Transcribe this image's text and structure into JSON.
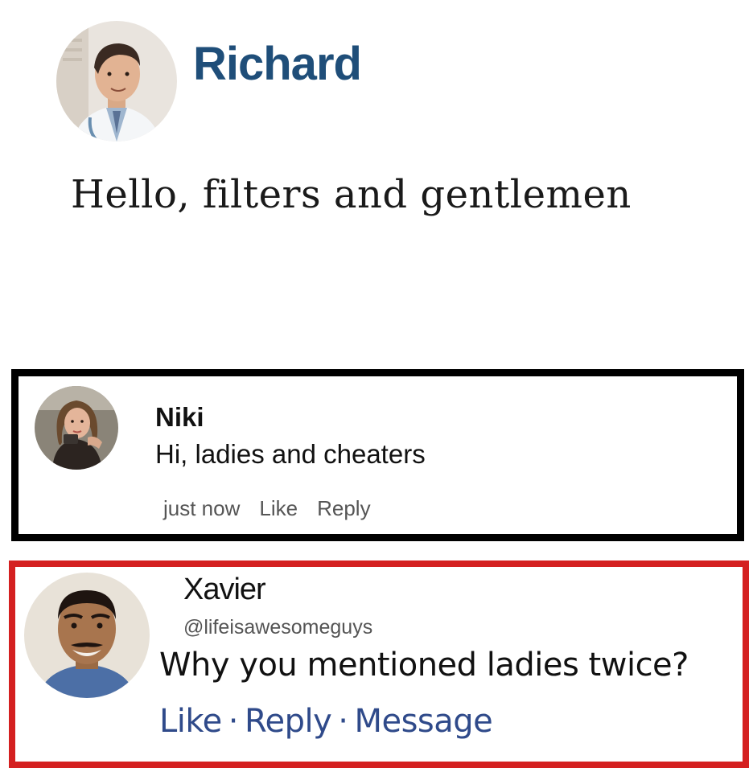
{
  "post": {
    "author": "Richard",
    "text": "Hello, filters and gentlemen",
    "colors": {
      "author_name": "#1f4e79"
    }
  },
  "comment_1": {
    "author": "Niki",
    "text": "Hi, ladies and cheaters",
    "timestamp": "just now",
    "like_label": "Like",
    "reply_label": "Reply",
    "frame_color": "#000000"
  },
  "comment_2": {
    "author": "Xavier",
    "handle": "@lifeisawesomeguys",
    "text": "Why you mentioned ladies twice?",
    "like_label": "Like",
    "reply_label": "Reply",
    "message_label": "Message",
    "separator": "·",
    "frame_color": "#d42020",
    "action_color": "#2f4a8a"
  },
  "icons": {
    "richard_avatar": "avatar-doctor-icon",
    "niki_avatar": "avatar-woman-icon",
    "xavier_avatar": "avatar-man-icon"
  }
}
